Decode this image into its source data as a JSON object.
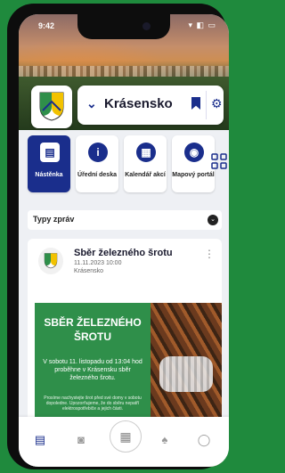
{
  "status_bar": {
    "time": "9:42",
    "icons": "▾ ◧ ▭"
  },
  "municipality": {
    "name": "Krásensko"
  },
  "tiles": [
    {
      "label": "Nástěnka",
      "icon": "dashboard-icon",
      "glyph": "▤",
      "active": true
    },
    {
      "label": "Úřední deska",
      "icon": "info-icon",
      "glyph": "i",
      "active": false
    },
    {
      "label": "Kalendář akcí",
      "icon": "calendar-icon",
      "glyph": "▦",
      "active": false
    },
    {
      "label": "Mapový portál",
      "icon": "map-pin-icon",
      "glyph": "◉",
      "active": false
    }
  ],
  "filter": {
    "label": "Typy zpráv"
  },
  "post": {
    "title": "Sběr železného šrotu",
    "date": "11.11.2023 10:00",
    "location": "Krásensko",
    "poster_heading": "SBĚR ŽELEZNÉHO ŠROTU",
    "poster_body": "V sobotu 11. listopadu od 13:04 hod proběhne v Krásensku sběr železného šrotu.",
    "poster_small": "Prosíme nachystejte šrot před své domy v sobotu dopoledne. Upozorňujeme, že do sběru nepatří elektrospotřebiče a jejich části."
  },
  "bottom_nav": [
    {
      "icon": "dashboard-icon",
      "glyph": "▤",
      "active": true
    },
    {
      "icon": "camera-icon",
      "glyph": "◙",
      "active": false
    },
    {
      "icon": "apps-icon",
      "glyph": "▦",
      "active": false
    },
    {
      "icon": "bell-icon",
      "glyph": "♠",
      "active": false
    },
    {
      "icon": "profile-icon",
      "glyph": "◯",
      "active": false
    }
  ]
}
